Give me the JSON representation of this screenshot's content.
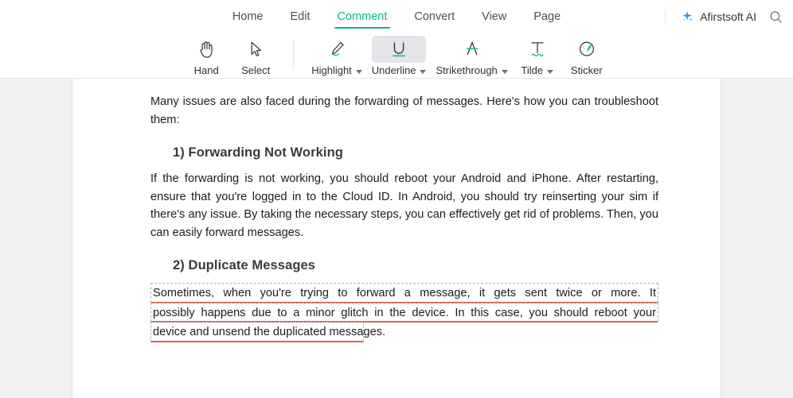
{
  "menu": {
    "tabs": [
      {
        "label": "Home",
        "active": false
      },
      {
        "label": "Edit",
        "active": false
      },
      {
        "label": "Comment",
        "active": true
      },
      {
        "label": "Convert",
        "active": false
      },
      {
        "label": "View",
        "active": false
      },
      {
        "label": "Page",
        "active": false
      }
    ],
    "ai_button_label": "Afirstsoft AI",
    "search_icon": "search-icon",
    "sparkle_icon": "sparkle-icon",
    "active_color": "#0cb87f"
  },
  "toolbar": {
    "tools": [
      {
        "label": "Hand",
        "icon": "hand-icon",
        "has_caret": false,
        "active": false
      },
      {
        "label": "Select",
        "icon": "cursor-icon",
        "has_caret": false,
        "active": false
      },
      {
        "label": "Highlight",
        "icon": "highlight-pen-icon",
        "has_caret": true,
        "active": false
      },
      {
        "label": "Underline",
        "icon": "underline-icon",
        "has_caret": true,
        "active": true
      },
      {
        "label": "Strikethrough",
        "icon": "strikethrough-icon",
        "has_caret": true,
        "active": false
      },
      {
        "label": "Tilde",
        "icon": "tilde-icon",
        "has_caret": true,
        "active": false
      },
      {
        "label": "Sticker",
        "icon": "sticker-leaf-icon",
        "has_caret": false,
        "active": false
      }
    ],
    "accent_color": "#19b87c",
    "active_bg": "#e3e5e8"
  },
  "document": {
    "intro_paragraph": "Many issues are also faced during the forwarding of messages. Here's how you can troubleshoot them:",
    "section_1": {
      "heading": "1) Forwarding Not Working",
      "paragraph": "If the forwarding is not working, you should reboot your Android and iPhone. After restarting, ensure that you're logged in to the Cloud ID. In Android, you should try reinserting your sim if there's any issue. By taking the necessary steps, you can effectively get rid of problems. Then, you can easily forward messages."
    },
    "section_2": {
      "heading": "2) Duplicate Messages",
      "annotated_paragraph": {
        "annotation_type": "underline",
        "annotation_color": "#e2614d",
        "selection_border_color": "#a9adb2",
        "lines": [
          "Sometimes, when you're trying to forward a message, it gets sent twice or more. It",
          "possibly happens due to a minor glitch in the device. In this case, you should reboot your",
          "device and unsend the duplicated messages."
        ]
      }
    }
  }
}
